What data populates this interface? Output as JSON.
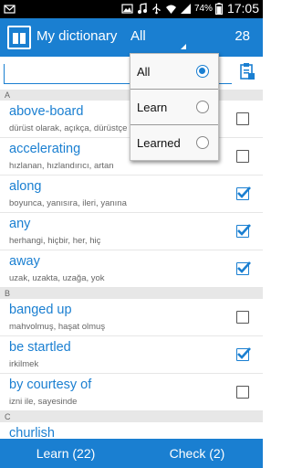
{
  "status_bar": {
    "battery": "74%",
    "time": "17:05",
    "icons": [
      "mail-icon",
      "image-icon",
      "music-icon",
      "usb-icon",
      "wifi-icon",
      "signal-icon",
      "battery-icon"
    ]
  },
  "action_bar": {
    "title": "My dictionary",
    "filter_value": "All",
    "count": "28",
    "accent_color": "#1a7fd1"
  },
  "search": {
    "value": "",
    "placeholder": ""
  },
  "dropdown": {
    "options": [
      {
        "label": "All",
        "selected": true
      },
      {
        "label": "Learn",
        "selected": false
      },
      {
        "label": "Learned",
        "selected": false
      }
    ]
  },
  "sections": [
    {
      "letter": "A",
      "items": [
        {
          "word": "above-board",
          "translation": "dürüst olarak, açıkça, dürüstçe",
          "checked": false
        },
        {
          "word": "accelerating",
          "translation": "hızlanan, hızlandırıcı, artan",
          "checked": false
        },
        {
          "word": "along",
          "translation": "boyunca, yanısıra, ileri, yanına",
          "checked": true
        },
        {
          "word": "any",
          "translation": "herhangi, hiçbir, her, hiç",
          "checked": true
        },
        {
          "word": "away",
          "translation": "uzak, uzakta, uzağa, yok",
          "checked": true
        }
      ]
    },
    {
      "letter": "B",
      "items": [
        {
          "word": "banged up",
          "translation": "mahvolmuş, haşat olmuş",
          "checked": false
        },
        {
          "word": "be startled",
          "translation": "irkilmek",
          "checked": true
        },
        {
          "word": "by courtesy of",
          "translation": "izni ile, sayesinde",
          "checked": false
        }
      ]
    },
    {
      "letter": "C",
      "items": [
        {
          "word": "churlish",
          "translation": "",
          "checked": false
        }
      ]
    }
  ],
  "bottom_bar": {
    "learn_label": "Learn (22)",
    "check_label": "Check (2)"
  }
}
